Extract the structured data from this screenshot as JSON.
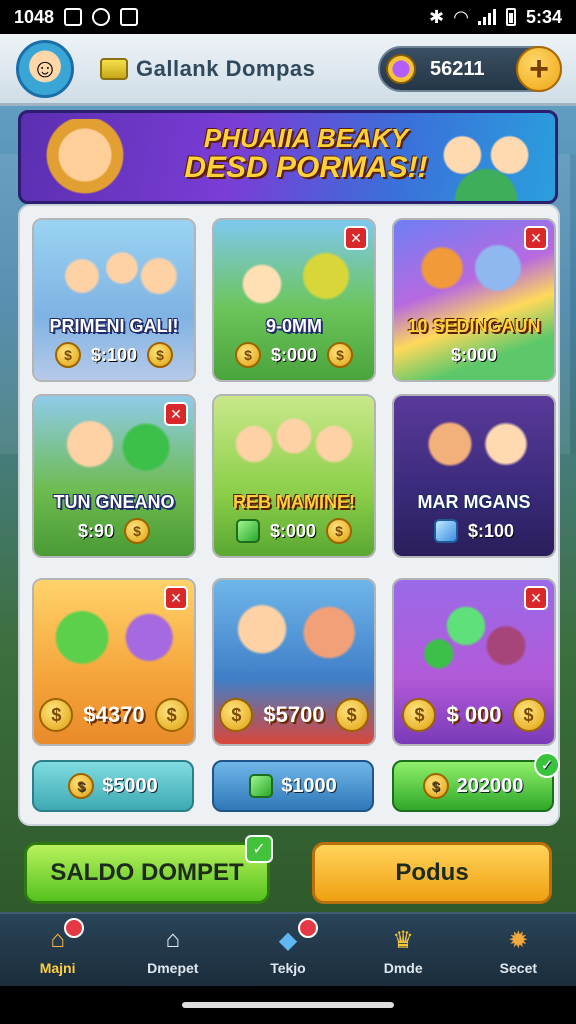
{
  "status_bar": {
    "time_left": "1048",
    "time_right": "5:34"
  },
  "header": {
    "title": "Gallank Dompas",
    "balance": "56211",
    "plus_label": "+"
  },
  "banner": {
    "line1": "PHUAIIA BEAKY",
    "line2": "DESD PORMAS!!"
  },
  "cards": [
    {
      "title": "PRIMENI GALI!",
      "price": "$:100"
    },
    {
      "title": "9-0MM",
      "price": "$:000"
    },
    {
      "title": "10 SEDINGAUN",
      "price": "$:000"
    },
    {
      "title": "TUN GNEANO",
      "price": "$:90"
    },
    {
      "title": "REB MAMINE!",
      "price": "$:000"
    },
    {
      "title": "MAR MGANS",
      "price": "$:100"
    },
    {
      "title": "",
      "price": "$4370"
    },
    {
      "title": "",
      "price": "$5700"
    },
    {
      "title": "",
      "price": "$ 000"
    }
  ],
  "pills": [
    {
      "value": "$5000"
    },
    {
      "value": "$1000"
    },
    {
      "value": "202000"
    }
  ],
  "actions": {
    "saldo": "SALDO DOMPET",
    "podus": "Podus"
  },
  "nav": [
    {
      "label": "Majni",
      "icon": "home-icon"
    },
    {
      "label": "Dmepet",
      "icon": "house-icon"
    },
    {
      "label": "Tekjo",
      "icon": "gem-icon"
    },
    {
      "label": "Dmde",
      "icon": "trophy-icon"
    },
    {
      "label": "Secet",
      "icon": "gear-icon"
    }
  ],
  "colors": {
    "accent_gold": "#ffd23a",
    "green": "#55c21e",
    "orange": "#f0a012"
  }
}
